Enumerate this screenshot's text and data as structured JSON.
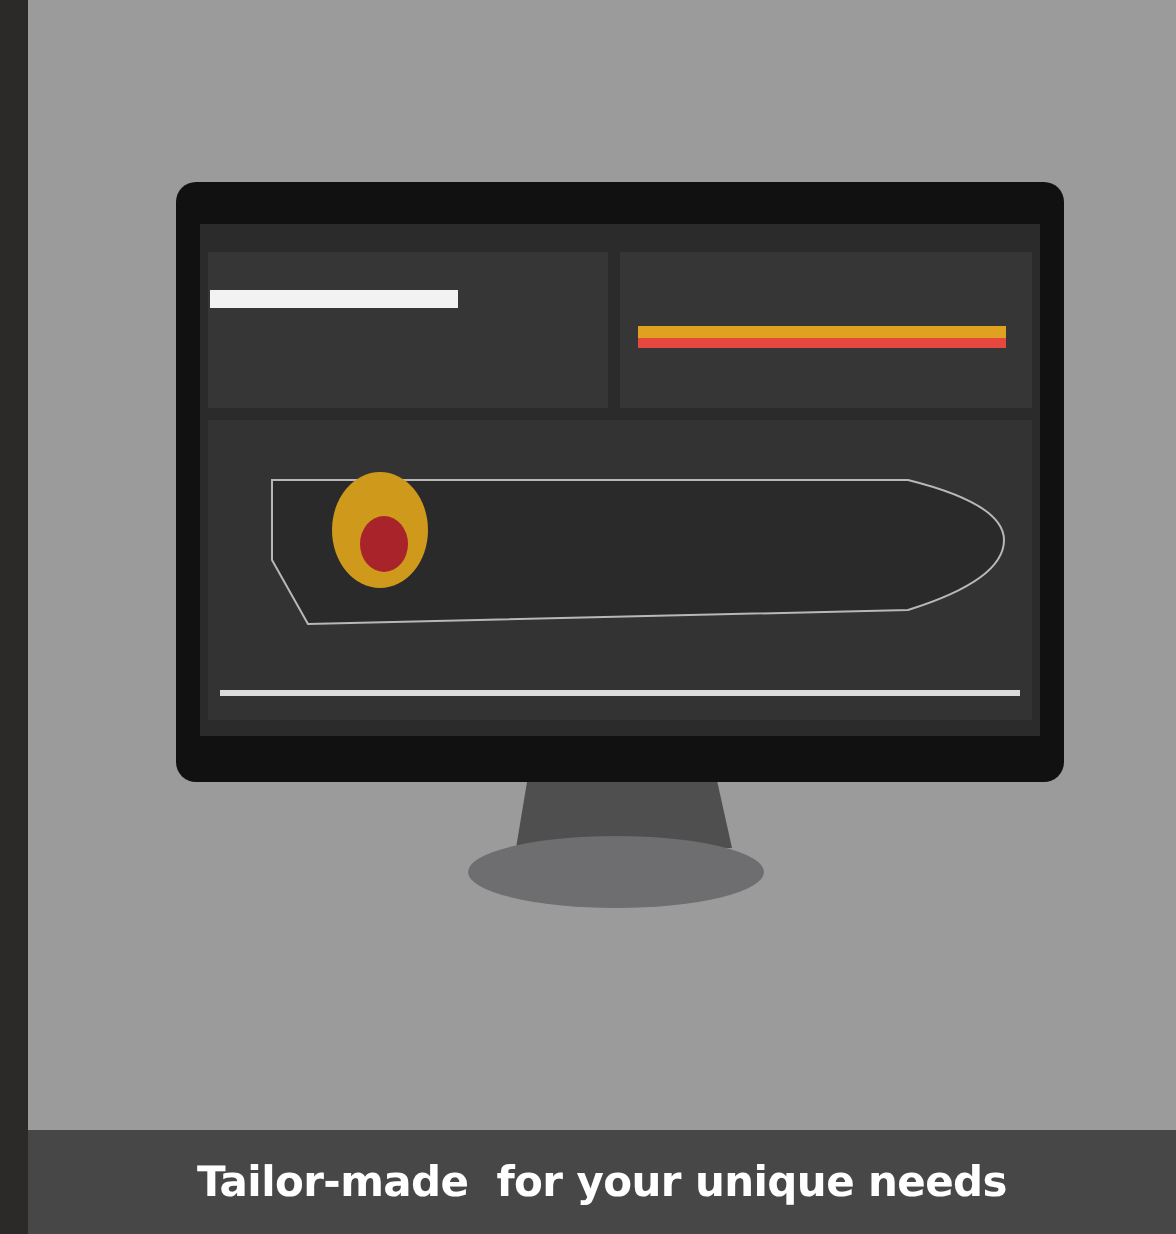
{
  "card": {
    "caption": "Tailor-made  for your unique needs"
  }
}
